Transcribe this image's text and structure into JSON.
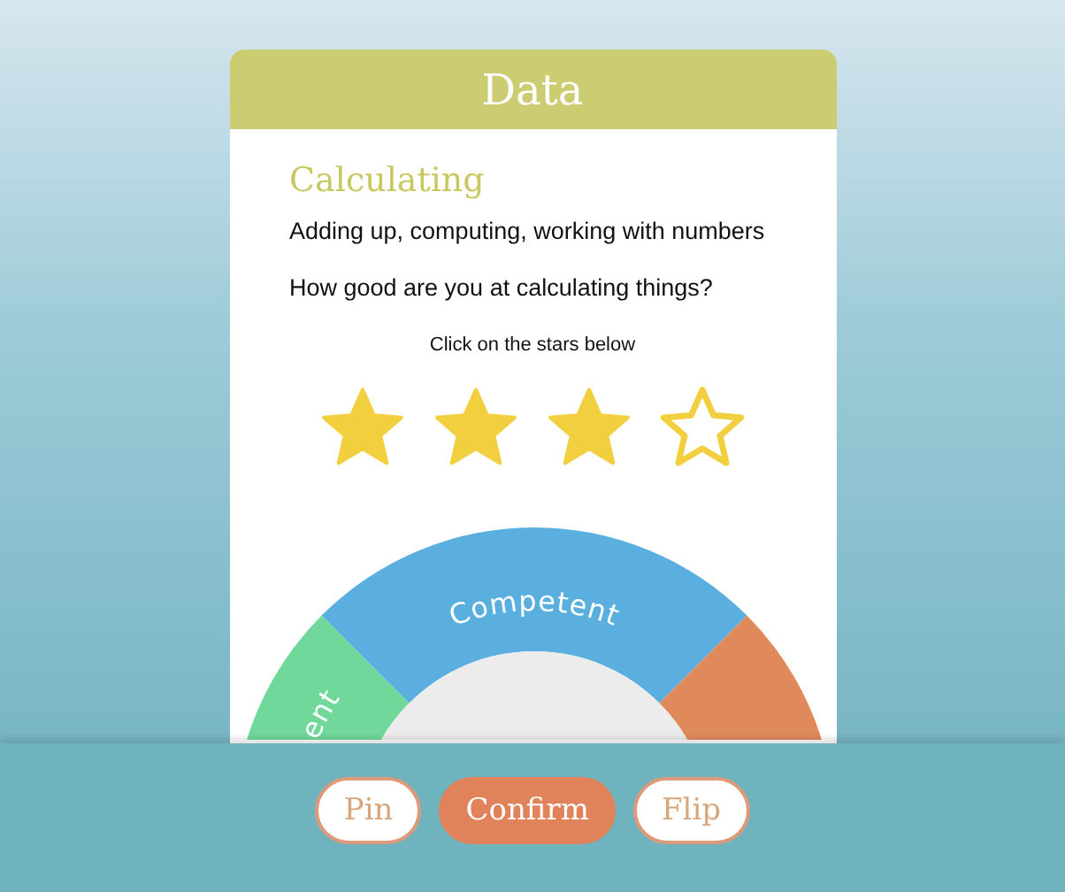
{
  "card": {
    "title": "Data",
    "skill": "Calculating",
    "description": "Adding up, computing, working with numbers",
    "question": "How good are you at calculating things?",
    "hint": "Click on the stars below",
    "stars": 3
  },
  "gauge": {
    "segments": [
      {
        "label": "ent",
        "color": "#6fd89a"
      },
      {
        "label": "Competent",
        "color": "#5aafdf"
      },
      {
        "color": "#e08a5c"
      }
    ]
  },
  "buttons": [
    {
      "label": "Pin",
      "kind": "outline"
    },
    {
      "label": "Confirm",
      "kind": "primary"
    },
    {
      "label": "Flip",
      "kind": "outline"
    }
  ]
}
